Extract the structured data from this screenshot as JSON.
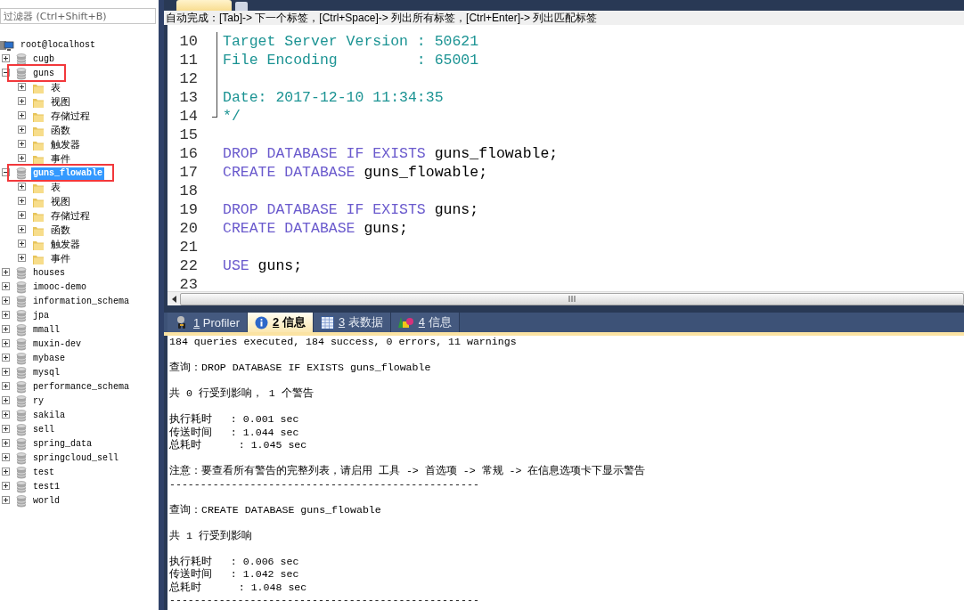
{
  "filter": {
    "placeholder": "过滤器 (Ctrl+Shift+B)"
  },
  "tree": {
    "label": "root@localhost",
    "kind": "server",
    "children": [
      {
        "label": "cugb",
        "kind": "database",
        "expanded": false,
        "selected": false,
        "annotated": false
      },
      {
        "label": "guns",
        "kind": "database",
        "expanded": true,
        "selected": false,
        "annotated": true,
        "children": [
          {
            "label": "表",
            "kind": "folder",
            "expanded": false
          },
          {
            "label": "视图",
            "kind": "folder",
            "expanded": false
          },
          {
            "label": "存储过程",
            "kind": "folder",
            "expanded": false
          },
          {
            "label": "函数",
            "kind": "folder",
            "expanded": false
          },
          {
            "label": "触发器",
            "kind": "folder",
            "expanded": false
          },
          {
            "label": "事件",
            "kind": "folder",
            "expanded": false
          }
        ]
      },
      {
        "label": "guns_flowable",
        "kind": "database",
        "expanded": true,
        "selected": true,
        "annotated": true,
        "children": [
          {
            "label": "表",
            "kind": "folder",
            "expanded": false
          },
          {
            "label": "视图",
            "kind": "folder",
            "expanded": false
          },
          {
            "label": "存储过程",
            "kind": "folder",
            "expanded": false
          },
          {
            "label": "函数",
            "kind": "folder",
            "expanded": false
          },
          {
            "label": "触发器",
            "kind": "folder",
            "expanded": false
          },
          {
            "label": "事件",
            "kind": "folder",
            "expanded": false
          }
        ]
      },
      {
        "label": "houses",
        "kind": "database",
        "expanded": false,
        "selected": false,
        "annotated": false
      },
      {
        "label": "imooc-demo",
        "kind": "database",
        "expanded": false,
        "selected": false,
        "annotated": false
      },
      {
        "label": "information_schema",
        "kind": "database",
        "expanded": false,
        "selected": false,
        "annotated": false
      },
      {
        "label": "jpa",
        "kind": "database",
        "expanded": false,
        "selected": false,
        "annotated": false
      },
      {
        "label": "mmall",
        "kind": "database",
        "expanded": false,
        "selected": false,
        "annotated": false
      },
      {
        "label": "muxin-dev",
        "kind": "database",
        "expanded": false,
        "selected": false,
        "annotated": false
      },
      {
        "label": "mybase",
        "kind": "database",
        "expanded": false,
        "selected": false,
        "annotated": false
      },
      {
        "label": "mysql",
        "kind": "database",
        "expanded": false,
        "selected": false,
        "annotated": false
      },
      {
        "label": "performance_schema",
        "kind": "database",
        "expanded": false,
        "selected": false,
        "annotated": false
      },
      {
        "label": "ry",
        "kind": "database",
        "expanded": false,
        "selected": false,
        "annotated": false
      },
      {
        "label": "sakila",
        "kind": "database",
        "expanded": false,
        "selected": false,
        "annotated": false
      },
      {
        "label": "sell",
        "kind": "database",
        "expanded": false,
        "selected": false,
        "annotated": false
      },
      {
        "label": "spring_data",
        "kind": "database",
        "expanded": false,
        "selected": false,
        "annotated": false
      },
      {
        "label": "springcloud_sell",
        "kind": "database",
        "expanded": false,
        "selected": false,
        "annotated": false
      },
      {
        "label": "test",
        "kind": "database",
        "expanded": false,
        "selected": false,
        "annotated": false
      },
      {
        "label": "test1",
        "kind": "database",
        "expanded": false,
        "selected": false,
        "annotated": false
      },
      {
        "label": "world",
        "kind": "database",
        "expanded": false,
        "selected": false,
        "annotated": false
      }
    ]
  },
  "autocomplete_hint": "自动完成：[Tab]-> 下一个标签，[Ctrl+Space]-> 列出所有标签，[Ctrl+Enter]-> 列出匹配标签",
  "editor": {
    "lines": [
      {
        "number": "10",
        "in_fold": true,
        "tokens": [
          {
            "text": "Target Server Version : 50621",
            "kind": "comment"
          }
        ]
      },
      {
        "number": "11",
        "in_fold": true,
        "tokens": [
          {
            "text": "File Encoding         : 65001",
            "kind": "comment"
          }
        ]
      },
      {
        "number": "12",
        "in_fold": true
      },
      {
        "number": "13",
        "in_fold": true,
        "tokens": [
          {
            "text": "Date: 2017-12-10 11:34:35",
            "kind": "comment"
          }
        ]
      },
      {
        "number": "14",
        "in_fold": true,
        "tokens": [
          {
            "text": "*/",
            "kind": "comment"
          }
        ]
      },
      {
        "number": "15",
        "in_fold": false
      },
      {
        "number": "16",
        "in_fold": false,
        "tokens": [
          {
            "text": "DROP DATABASE IF EXISTS ",
            "kind": "keyword"
          },
          {
            "text": "guns_flowable;",
            "kind": "plain"
          }
        ]
      },
      {
        "number": "17",
        "in_fold": false,
        "tokens": [
          {
            "text": "CREATE DATABASE ",
            "kind": "keyword"
          },
          {
            "text": "guns_flowable;",
            "kind": "plain"
          }
        ]
      },
      {
        "number": "18",
        "in_fold": false
      },
      {
        "number": "19",
        "in_fold": false,
        "tokens": [
          {
            "text": "DROP DATABASE IF EXISTS ",
            "kind": "keyword"
          },
          {
            "text": "guns;",
            "kind": "plain"
          }
        ]
      },
      {
        "number": "20",
        "in_fold": false,
        "tokens": [
          {
            "text": "CREATE DATABASE ",
            "kind": "keyword"
          },
          {
            "text": "guns;",
            "kind": "plain"
          }
        ]
      },
      {
        "number": "21",
        "in_fold": false
      },
      {
        "number": "22",
        "in_fold": false,
        "tokens": [
          {
            "text": "USE ",
            "kind": "keyword"
          },
          {
            "text": "guns;",
            "kind": "plain"
          }
        ]
      },
      {
        "number": "23",
        "in_fold": false
      }
    ]
  },
  "result_tabs": [
    {
      "key": "1",
      "label": "Profiler",
      "kind": "profiler",
      "selected": false
    },
    {
      "key": "2",
      "label": "信息",
      "kind": "info",
      "selected": true
    },
    {
      "key": "3",
      "label": "表数据",
      "kind": "table",
      "selected": false
    },
    {
      "key": "4",
      "label": "信息",
      "kind": "shapes",
      "selected": false
    }
  ],
  "output": {
    "blocks": [
      [
        "184 queries executed, 184 success, 0 errors, 11 warnings"
      ],
      [
        "查询：DROP DATABASE IF EXISTS guns_flowable"
      ],
      [
        "共 0 行受到影响， 1 个警告"
      ],
      [
        "执行耗时   : 0.001 sec",
        "传送时间   : 1.044 sec",
        "总耗时      : 1.045 sec"
      ],
      [
        "注意：要查看所有警告的完整列表，请启用 工具 -> 首选项 -> 常规 -> 在信息选项卡下显示警告",
        "--------------------------------------------------"
      ],
      [
        "查询：CREATE DATABASE guns_flowable"
      ],
      [
        "共 1 行受到影响"
      ],
      [
        "执行耗时   : 0.006 sec",
        "传送时间   : 1.042 sec",
        "总耗时      : 1.048 sec",
        "--------------------------------------------------"
      ]
    ]
  }
}
